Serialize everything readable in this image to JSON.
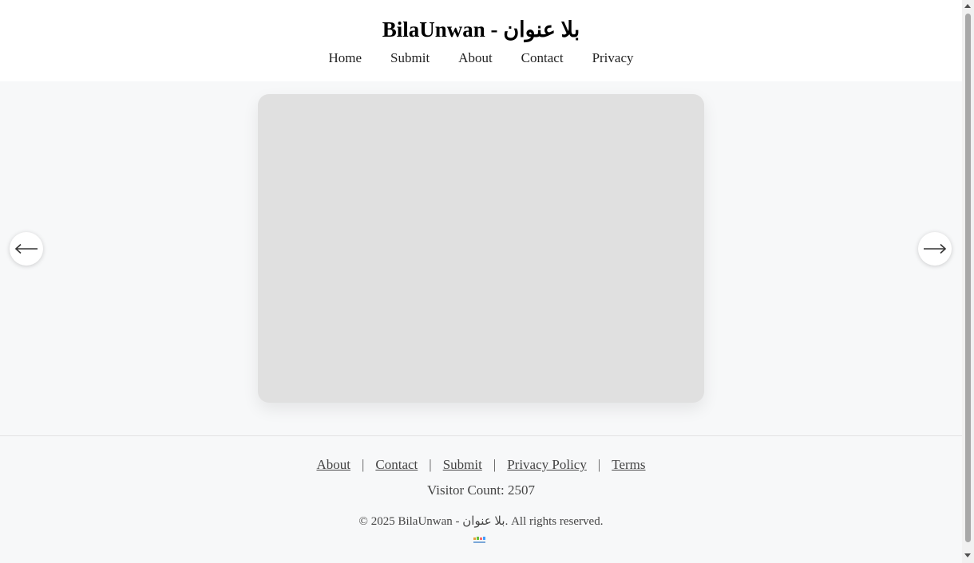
{
  "site": {
    "title": "BilaUnwan - بلا عنوان"
  },
  "nav": {
    "items": [
      {
        "label": "Home"
      },
      {
        "label": "Submit"
      },
      {
        "label": "About"
      },
      {
        "label": "Contact"
      },
      {
        "label": "Privacy"
      }
    ]
  },
  "carousel": {
    "prev_icon": "arrow-left-icon",
    "next_icon": "arrow-right-icon"
  },
  "footer": {
    "links": [
      {
        "label": "About"
      },
      {
        "label": "Contact"
      },
      {
        "label": "Submit"
      },
      {
        "label": "Privacy Policy"
      },
      {
        "label": "Terms"
      }
    ],
    "separator": "|",
    "visitor_count": "Visitor Count: 2507",
    "copyright": "© 2025 BilaUnwan - بلا عنوان. All rights reserved."
  }
}
